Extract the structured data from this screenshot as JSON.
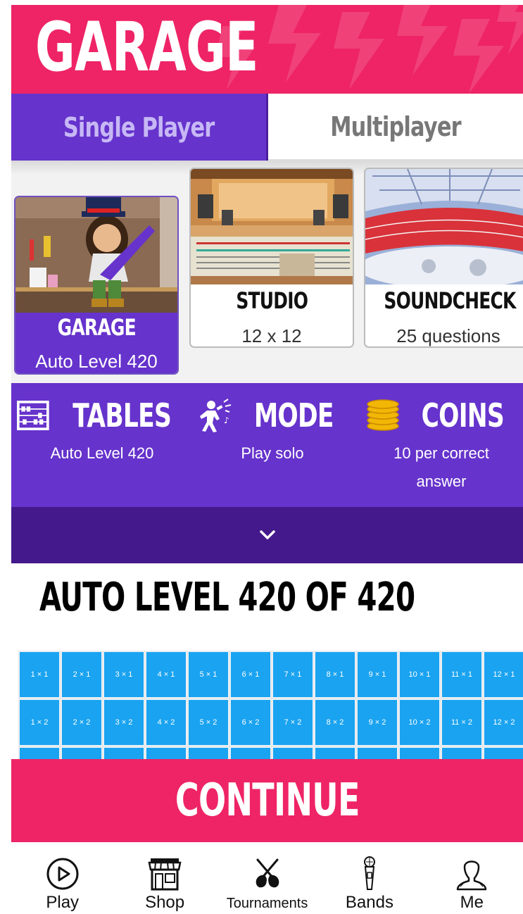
{
  "header": {
    "title": "GARAGE"
  },
  "tabs": [
    {
      "label": "Single Player",
      "active": true
    },
    {
      "label": "Multiplayer",
      "active": false
    }
  ],
  "modes": [
    {
      "title": "GARAGE",
      "subtitle": "Auto Level 420",
      "selected": true
    },
    {
      "title": "STUDIO",
      "subtitle": "12 x 12",
      "selected": false
    },
    {
      "title": "SOUNDCHECK",
      "subtitle": "25 questions",
      "selected": false
    }
  ],
  "info": {
    "tables": {
      "label": "TABLES",
      "value": "Auto Level 420",
      "icon": "abacus-icon"
    },
    "mode": {
      "label": "MODE",
      "value": "Play solo",
      "icon": "singer-icon"
    },
    "coins": {
      "label": "COINS",
      "value": "10 per correct answer",
      "icon": "coins-icon"
    }
  },
  "level_title": "AUTO LEVEL 420 OF 420",
  "grid": {
    "row1": [
      "1 × 1",
      "2 × 1",
      "3 × 1",
      "4 × 1",
      "5 × 1",
      "6 × 1",
      "7 × 1",
      "8 × 1",
      "9 × 1",
      "10 × 1",
      "11 × 1",
      "12 × 1"
    ],
    "row2": [
      "1 × 2",
      "2 × 2",
      "3 × 2",
      "4 × 2",
      "5 × 2",
      "6 × 2",
      "7 × 2",
      "8 × 2",
      "9 × 2",
      "10 × 2",
      "11 × 2",
      "12 × 2"
    ]
  },
  "continue_label": "CONTINUE",
  "nav": [
    {
      "label": "Play",
      "icon": "play-icon"
    },
    {
      "label": "Shop",
      "icon": "shop-icon"
    },
    {
      "label": "Tournaments",
      "icon": "guitars-icon"
    },
    {
      "label": "Bands",
      "icon": "microphone-icon"
    },
    {
      "label": "Me",
      "icon": "user-icon"
    }
  ],
  "colors": {
    "pink": "#ee2466",
    "purple": "#6633cc",
    "dark_purple": "#44198c",
    "grid_blue": "#1aa3f0"
  }
}
